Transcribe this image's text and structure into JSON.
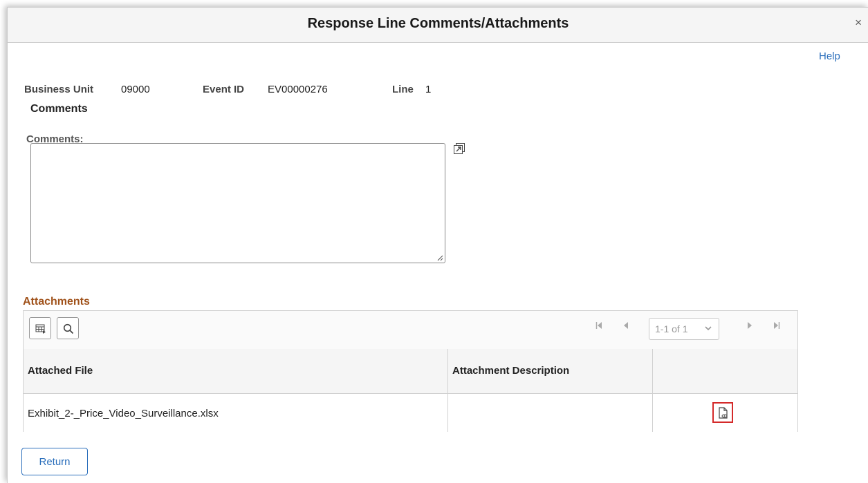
{
  "window": {
    "title": "Response Line Comments/Attachments",
    "close_label": "×",
    "help_label": "Help"
  },
  "header": {
    "business_unit_label": "Business Unit",
    "business_unit_value": "09000",
    "event_id_label": "Event ID",
    "event_id_value": "EV00000276",
    "line_label": "Line",
    "line_value": "1"
  },
  "comments": {
    "section_title": "Comments",
    "field_label": "Comments:",
    "value": ""
  },
  "attachments": {
    "section_title": "Attachments",
    "pager": {
      "first": "⏮",
      "prev": "◀",
      "range": "1-1 of 1",
      "next": "▶",
      "last": "⏭"
    },
    "columns": [
      "Attached File",
      "Attachment Description",
      ""
    ],
    "rows": [
      {
        "file": "Exhibit_2-_Price_Video_Surveillance.xlsx",
        "description": ""
      }
    ],
    "highlight_color": "#d42a2a"
  },
  "footer": {
    "return_label": "Return"
  },
  "colors": {
    "link": "#2a6ebb",
    "section_accent": "#a0521b"
  }
}
